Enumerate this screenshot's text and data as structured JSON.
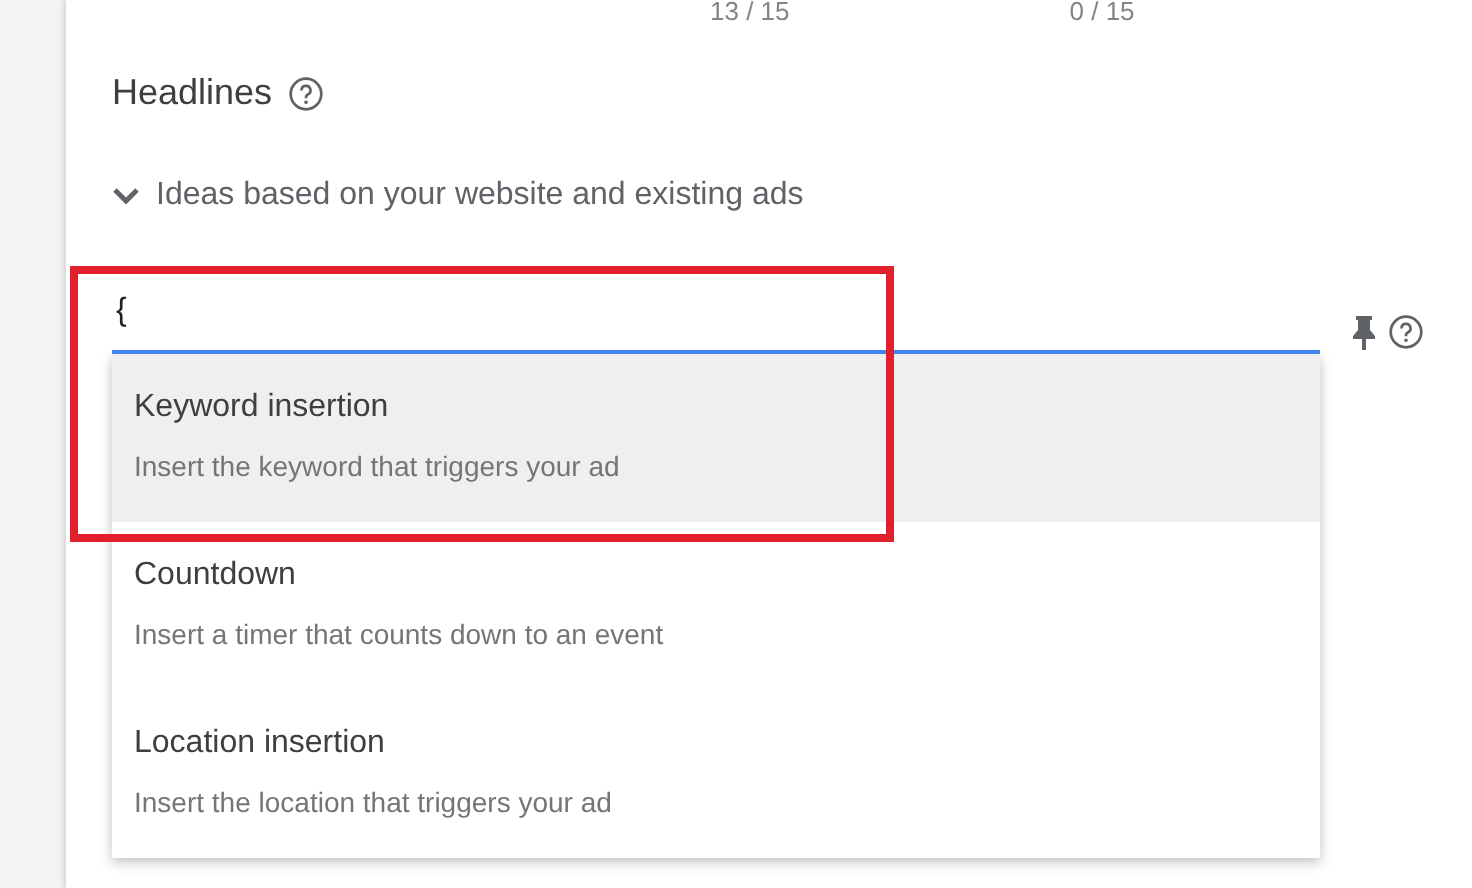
{
  "counters": [
    "13 / 15",
    "0 / 15"
  ],
  "section": {
    "title": "Headlines",
    "ideas_toggle": {
      "label": "Ideas based on your website and existing ads",
      "expanded": false
    }
  },
  "headline_input": {
    "value": "{",
    "focused": true
  },
  "suggestions": [
    {
      "title": "Keyword insertion",
      "description": "Insert the keyword that triggers your ad",
      "selected": true
    },
    {
      "title": "Countdown",
      "description": "Insert a timer that counts down to an event",
      "selected": false
    },
    {
      "title": "Location insertion",
      "description": "Insert the location that triggers your ad",
      "selected": false
    }
  ],
  "annotation": {
    "shown": true
  }
}
